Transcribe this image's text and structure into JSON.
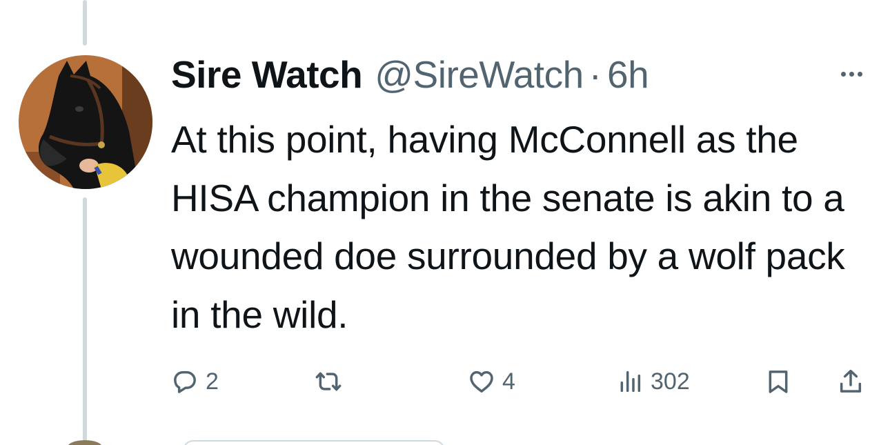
{
  "tweet": {
    "display_name": "Sire Watch",
    "handle": "@SireWatch",
    "separator": "·",
    "time": "6h",
    "text": "At this point, having McConnell as the HISA champion in the senate is akin to a wounded doe surrounded by a wolf pack in the wild."
  },
  "actions": {
    "replies": "2",
    "likes": "4",
    "views": "302"
  },
  "icons": {
    "more": "more-horizontal-icon",
    "reply": "reply-icon",
    "retweet": "retweet-icon",
    "like": "heart-icon",
    "views": "analytics-icon",
    "bookmark": "bookmark-icon",
    "share": "share-icon"
  },
  "colors": {
    "text_primary": "#0f1419",
    "text_secondary": "#536471",
    "thread_line": "#cfd9de"
  }
}
